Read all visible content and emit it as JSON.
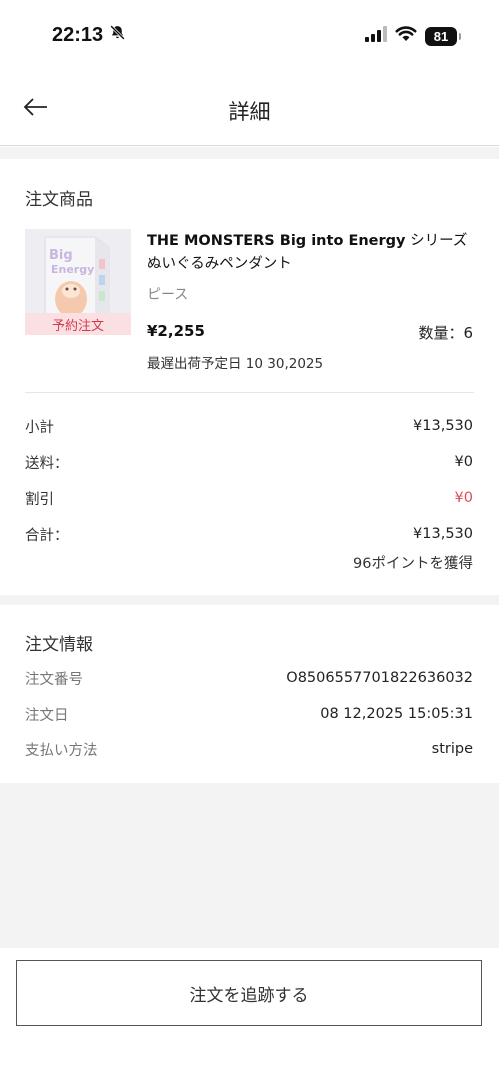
{
  "status_bar": {
    "time": "22:13",
    "battery": "81",
    "icons": [
      "bell-slash-icon",
      "signal-icon",
      "wifi-icon",
      "battery-icon"
    ]
  },
  "nav": {
    "title": "詳細",
    "back_icon": "arrow-left-icon"
  },
  "order_items": {
    "section_title": "注文商品",
    "product": {
      "name_en": "THE MONSTERS Big into Energy",
      "name_jp": " シリーズぬいぐるみペンダント",
      "variant": "ピース",
      "tag": "予約注文",
      "price": "¥2,255",
      "quantity": "数量：6",
      "ship_date": "最遅出荷予定日 10 30,2025"
    }
  },
  "summary": {
    "subtotal_label": "小計",
    "subtotal_value": "¥13,530",
    "shipping_label": "送料：",
    "shipping_value": "¥0",
    "discount_label": "割引",
    "discount_value": "¥0",
    "total_label": "合計：",
    "total_value": "¥13,530",
    "points": "96ポイントを獲得"
  },
  "order_info": {
    "section_title": "注文情報",
    "number_label": "注文番号",
    "number_value": "O8506557701822636032",
    "date_label": "注文日",
    "date_value": "08 12,2025 15:05:31",
    "payment_label": "支払い方法",
    "payment_value": "stripe"
  },
  "actions": {
    "track_label": "注文を追跡する"
  },
  "colors": {
    "accent_red": "#e04a5a",
    "tag_bg": "#fbe0e3",
    "background_gray": "#f3f3f3"
  }
}
